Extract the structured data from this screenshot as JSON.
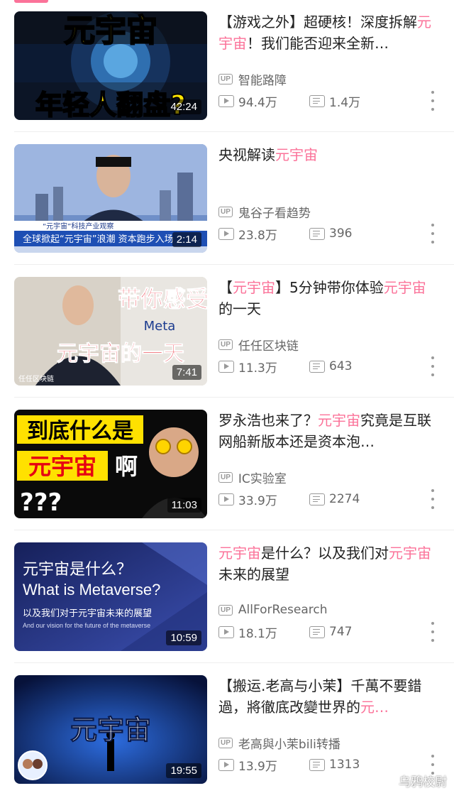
{
  "videos": [
    {
      "title_segments": [
        {
          "text": "【游戏之外】超硬核！深度拆解",
          "kw": false
        },
        {
          "text": "元宇宙",
          "kw": true
        },
        {
          "text": "！我们能否迎来全新…",
          "kw": false
        }
      ],
      "uploader": "智能路障",
      "views": "94.4万",
      "danmaku": "1.4万",
      "duration": "42:24",
      "thumb": {
        "lines": [
          "元宇宙",
          "年轻人翻盘?"
        ]
      }
    },
    {
      "title_segments": [
        {
          "text": "央视解读",
          "kw": false
        },
        {
          "text": "元宇宙",
          "kw": true
        }
      ],
      "uploader": "鬼谷子看趋势",
      "views": "23.8万",
      "danmaku": "396",
      "duration": "2:14",
      "thumb": {
        "lines": [
          "“元宇宙”科技产业观察",
          "全球掀起“元宇宙”浪潮 资本跑步入场"
        ]
      }
    },
    {
      "title_segments": [
        {
          "text": "【",
          "kw": false
        },
        {
          "text": "元宇宙",
          "kw": true
        },
        {
          "text": "】5分钟带你体验",
          "kw": false
        },
        {
          "text": "元宇宙",
          "kw": true
        },
        {
          "text": "的一天",
          "kw": false
        }
      ],
      "uploader": "任任区块链",
      "views": "11.3万",
      "danmaku": "643",
      "duration": "7:41",
      "thumb": {
        "lines": [
          "带你感受",
          "Meta",
          "元宇宙的一天",
          "任任区块链"
        ]
      }
    },
    {
      "title_segments": [
        {
          "text": "罗永浩也来了？",
          "kw": false
        },
        {
          "text": "元宇宙",
          "kw": true
        },
        {
          "text": "究竟是互联网船新版本还是资本泡…",
          "kw": false
        }
      ],
      "uploader": "IC实验室",
      "views": "33.9万",
      "danmaku": "2274",
      "duration": "11:03",
      "thumb": {
        "lines": [
          "到底什么是",
          "元宇宙",
          "啊",
          "???"
        ]
      }
    },
    {
      "title_segments": [
        {
          "text": "元宇宙",
          "kw": true
        },
        {
          "text": "是什么？以及我们对",
          "kw": false
        },
        {
          "text": "元宇宙",
          "kw": true
        },
        {
          "text": "未来的展望",
          "kw": false
        }
      ],
      "uploader": "AllForResearch",
      "views": "18.1万",
      "danmaku": "747",
      "duration": "10:59",
      "thumb": {
        "lines": [
          "元宇宙是什么？",
          "What is Metaverse?",
          "以及我们对于元宇宙未来的展望",
          "And our vision for the future of the metaverse"
        ]
      }
    },
    {
      "title_segments": [
        {
          "text": "【搬运.老高与小茉】千萬不要錯過，將徹底改變世界的",
          "kw": false
        },
        {
          "text": "元…",
          "kw": true
        }
      ],
      "uploader": "老高與小茉bili转播",
      "views": "13.9万",
      "danmaku": "1313",
      "duration": "19:55",
      "thumb": {
        "lines": [
          "元宇宙"
        ]
      }
    }
  ],
  "watermark": "乌鸦校尉",
  "colors": {
    "accent": "#fb7299",
    "meta": "#999999"
  }
}
